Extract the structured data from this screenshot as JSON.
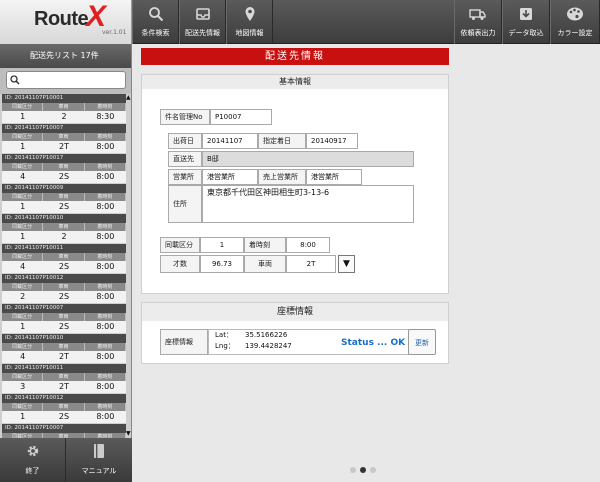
{
  "app": {
    "logo_text": "Route",
    "logo_x": "X",
    "version": "ver.1.01"
  },
  "toolbar": {
    "left_buttons": [
      {
        "label": "条件検索",
        "icon": "search-icon"
      },
      {
        "label": "配送先情報",
        "icon": "inbox-icon"
      },
      {
        "label": "地図情報",
        "icon": "map-pin-icon"
      }
    ],
    "right_buttons": [
      {
        "label": "依頼表出力",
        "icon": "truck-icon"
      },
      {
        "label": "データ取込",
        "icon": "download-icon"
      },
      {
        "label": "カラー設定",
        "icon": "palette-icon"
      }
    ]
  },
  "sidebar": {
    "title": "配送先リスト 17件",
    "search": {
      "placeholder": "",
      "value": ""
    },
    "col_headers": [
      "同載区分",
      "車両",
      "着時刻"
    ],
    "items": [
      {
        "id": "ID:  20141107P10001",
        "group": "1",
        "vehicle": "2",
        "time": "8:30"
      },
      {
        "id": "ID:  20141107P10007",
        "group": "1",
        "vehicle": "2T",
        "time": "8:00"
      },
      {
        "id": "ID:  20141107P10017",
        "group": "4",
        "vehicle": "2S",
        "time": "8:00"
      },
      {
        "id": "ID:  20141107P10009",
        "group": "1",
        "vehicle": "2S",
        "time": "8:00"
      },
      {
        "id": "ID:  20141107P10010",
        "group": "1",
        "vehicle": "2",
        "time": "8:00"
      },
      {
        "id": "ID:  20141107P10011",
        "group": "4",
        "vehicle": "2S",
        "time": "8:00"
      },
      {
        "id": "ID:  20141107P10012",
        "group": "2",
        "vehicle": "2S",
        "time": "8:00"
      },
      {
        "id": "ID:  20141107P10007",
        "group": "1",
        "vehicle": "2S",
        "time": "8:00"
      },
      {
        "id": "ID:  20141107P10010",
        "group": "4",
        "vehicle": "2T",
        "time": "8:00"
      },
      {
        "id": "ID:  20141107P10011",
        "group": "3",
        "vehicle": "2T",
        "time": "8:00"
      },
      {
        "id": "ID:  20141107P10012",
        "group": "1",
        "vehicle": "2S",
        "time": "8:00"
      },
      {
        "id": "ID:  20141107P10007",
        "group": "",
        "vehicle": "",
        "time": ""
      }
    ],
    "bottom_buttons": [
      {
        "label": "終了",
        "icon": "gear-icon"
      },
      {
        "label": "マニュアル",
        "icon": "book-icon"
      }
    ]
  },
  "main": {
    "title": "配送先情報",
    "basic": {
      "header": "基本情報",
      "case_no_label": "件名管理No",
      "case_no": "P10007",
      "ship_date_label": "出荷日",
      "ship_date": "20141107",
      "delivery_date_label": "指定着日",
      "delivery_date": "20140917",
      "destination_label": "直送先",
      "destination": "B邸",
      "office_label": "営業所",
      "office": "港営業所",
      "sales_office_label": "売上営業所",
      "sales_office": "港営業所",
      "address_label": "住所",
      "address": "東京都千代田区神田相生町3-13-6",
      "group_label": "同載区分",
      "group": "1",
      "arrival_label": "着時刻",
      "arrival": "8:00",
      "size_label": "才数",
      "size": "96.73",
      "vehicle_label": "車両",
      "vehicle": "2T",
      "dropdown_glyph": "▼"
    },
    "coords": {
      "header": "座標情報",
      "label": "座標情報",
      "lat_label": "Lat：",
      "lat": "35.5166226",
      "lng_label": "Lng：",
      "lng": "139.4428247",
      "status": "Status ... OK",
      "update_label": "更新"
    }
  },
  "pager": {
    "count": 3,
    "active_index": 1
  }
}
